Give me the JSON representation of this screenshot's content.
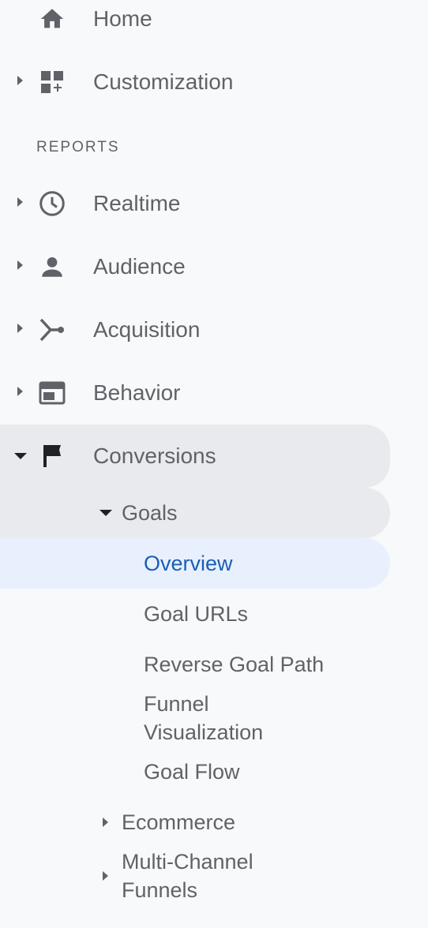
{
  "nav": {
    "home": {
      "label": "Home",
      "icon": "home-icon"
    },
    "customization": {
      "label": "Customization",
      "icon": "dashboard-add-icon"
    },
    "section_header": "REPORTS",
    "realtime": {
      "label": "Realtime",
      "icon": "clock-icon"
    },
    "audience": {
      "label": "Audience",
      "icon": "person-icon"
    },
    "acquisition": {
      "label": "Acquisition",
      "icon": "merge-icon"
    },
    "behavior": {
      "label": "Behavior",
      "icon": "web-layout-icon"
    },
    "conversions": {
      "label": "Conversions",
      "icon": "flag-icon",
      "expanded": true,
      "goals": {
        "label": "Goals",
        "expanded": true,
        "items": {
          "overview": "Overview",
          "goal_urls": "Goal URLs",
          "reverse_goal_path": "Reverse Goal Path",
          "funnel_visualization_line1": "Funnel",
          "funnel_visualization_line2": "Visualization",
          "goal_flow": "Goal Flow"
        }
      },
      "ecommerce": "Ecommerce",
      "multi_channel_funnels_line1": "Multi-Channel",
      "multi_channel_funnels_line2": "Funnels"
    }
  },
  "colors": {
    "background": "#f8f9fa",
    "text": "#5f6368",
    "selected_group": "#e8eaed",
    "active_bg": "#e8f0fe",
    "active_text": "#1a5fb4"
  },
  "active_item": "Overview"
}
